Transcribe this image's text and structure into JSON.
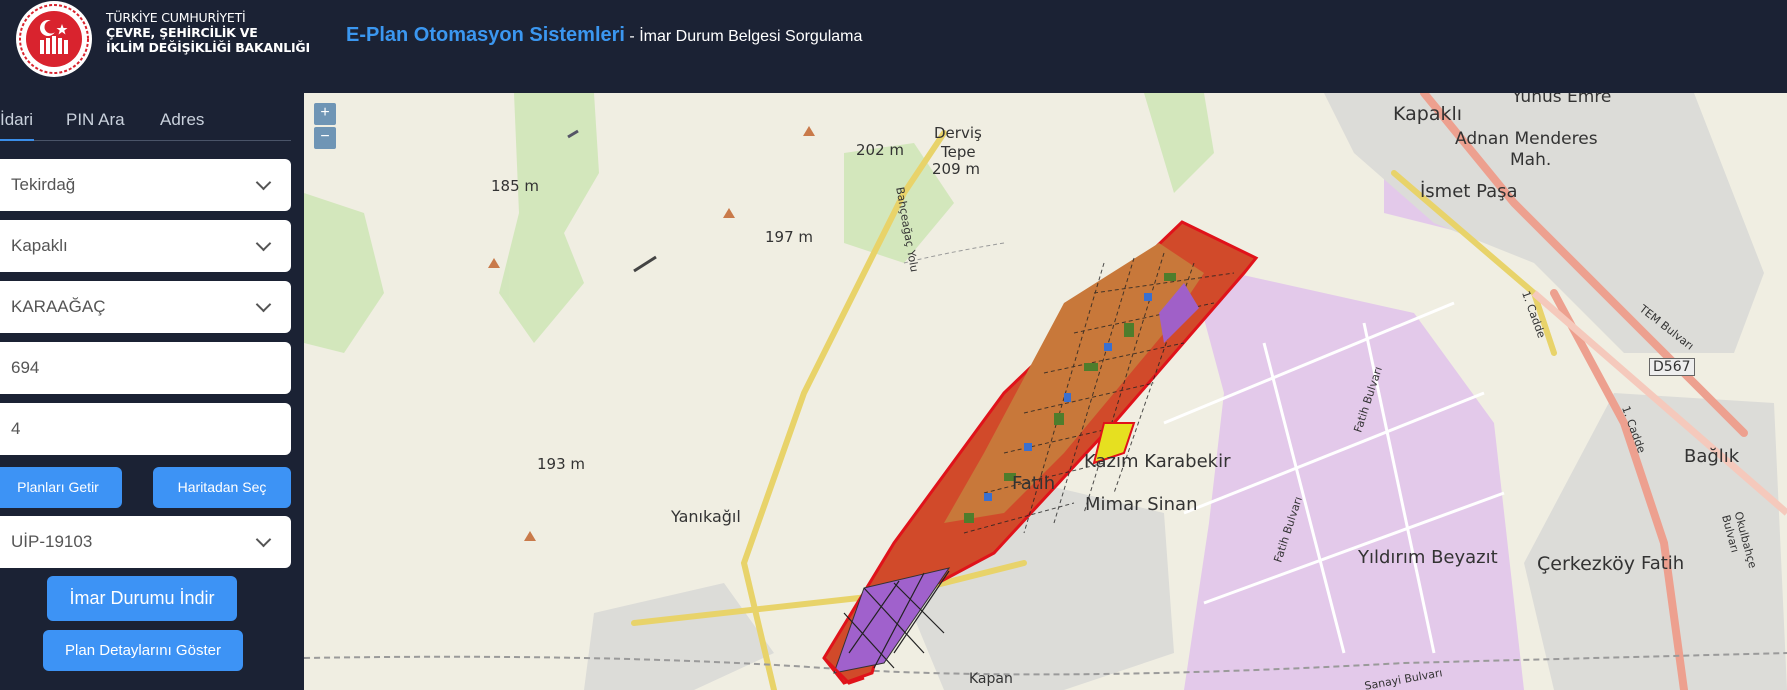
{
  "header": {
    "ministry_line1": "TÜRKİYE CUMHURİYETİ",
    "ministry_line2": "ÇEVRE, ŞEHİRCİLİK VE",
    "ministry_line3": "İKLİM DEĞİŞİKLİĞİ BAKANLIĞI",
    "app_name": "E-Plan Otomasyon Sistemleri",
    "app_subtitle": " - İmar Durum Belgesi Sorgulama"
  },
  "tabs": [
    {
      "label": "İdari",
      "active": true
    },
    {
      "label": "PIN Ara",
      "active": false
    },
    {
      "label": "Adres",
      "active": false
    }
  ],
  "form": {
    "province": "Tekirdağ",
    "district": "Kapaklı",
    "neighborhood": "KARAAĞAÇ",
    "block": "694",
    "parcel": "4",
    "get_plans_label": "Planları Getir",
    "select_from_map_label": "Haritadan Seç",
    "plan": "UİP-19103",
    "download_label": "İmar Durumu İndir",
    "details_label": "Plan Detaylarını Göster"
  },
  "map": {
    "zoom_in": "+",
    "zoom_out": "−",
    "labels": [
      {
        "text": "Yunus Emre",
        "size": 17
      },
      {
        "text": "Kapaklı",
        "size": 19
      },
      {
        "text": "Adnan Menderes",
        "size": 17
      },
      {
        "text": "Mah.",
        "size": 17
      },
      {
        "text": "İsmet Paşa",
        "size": 18
      },
      {
        "text": "Derviş",
        "size": 15
      },
      {
        "text": "Tepe",
        "size": 15
      },
      {
        "text": "209 m",
        "size": 15
      },
      {
        "text": "202 m",
        "size": 15
      },
      {
        "text": "185 m",
        "size": 15
      },
      {
        "text": "197 m",
        "size": 15
      },
      {
        "text": "193 m",
        "size": 15
      },
      {
        "text": "Kazım Karabekir",
        "size": 18
      },
      {
        "text": "Fatih",
        "size": 18
      },
      {
        "text": "Mimar Sinan",
        "size": 18
      },
      {
        "text": "Yanıkağıl",
        "size": 16
      },
      {
        "text": "Yıldırım Beyazıt",
        "size": 18
      },
      {
        "text": "Çerkezköy",
        "size": 19
      },
      {
        "text": "Fatih",
        "size": 18
      },
      {
        "text": "Bağlık",
        "size": 18
      },
      {
        "text": "D567",
        "size": 14
      },
      {
        "text": "TEM Bulvarı",
        "size": 11
      },
      {
        "text": "Fatih Bulvarı",
        "size": 11
      },
      {
        "text": "Fatih Bulvarı",
        "size": 11
      },
      {
        "text": "1. Cadde",
        "size": 11
      },
      {
        "text": "1. Cadde",
        "size": 11
      },
      {
        "text": "Sanayi Bulvarı",
        "size": 11
      },
      {
        "text": "Bahçeağaç Yolu",
        "size": 11
      },
      {
        "text": "Kapan",
        "size": 14
      },
      {
        "text": "Okulbahçe Bulvarı",
        "size": 11
      }
    ]
  },
  "colors": {
    "accent": "#3d93f5",
    "header_bg": "#1b2234",
    "plan_outline": "#e0121a"
  }
}
